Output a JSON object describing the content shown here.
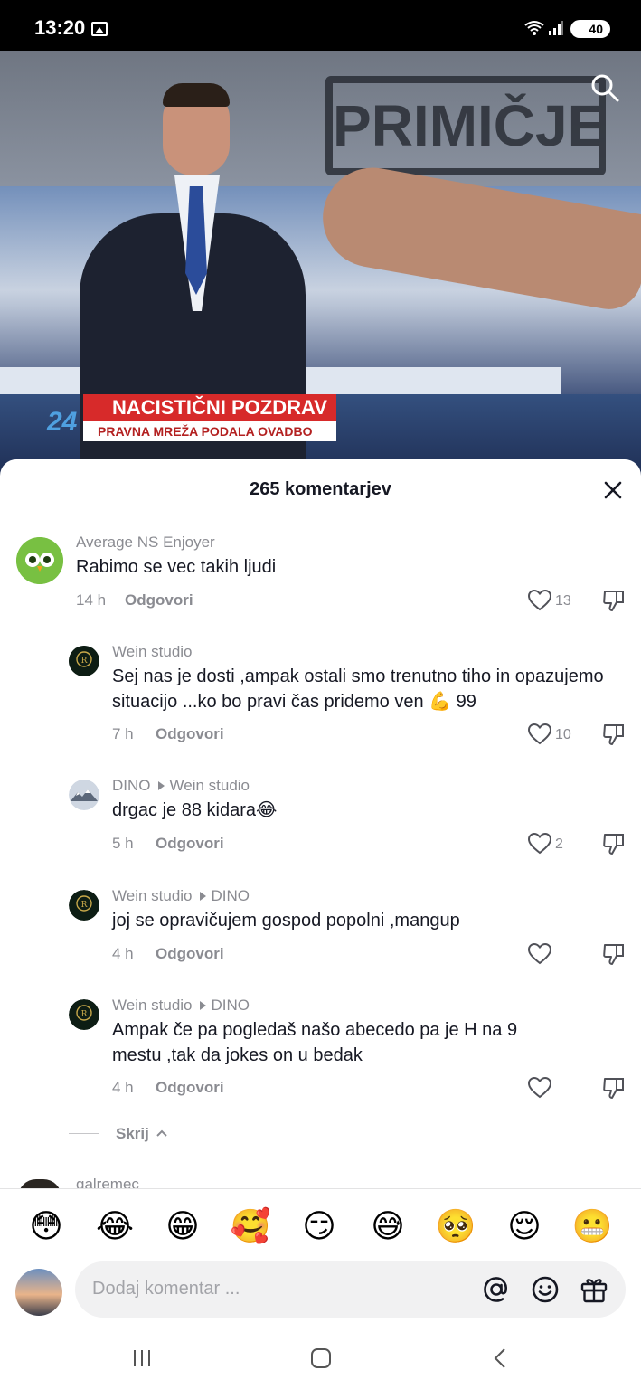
{
  "status_bar": {
    "time": "13:20",
    "battery": "40"
  },
  "video": {
    "studio_logo": "PRIMIČJE",
    "channel_mark": "24",
    "headline": "NACISTIČNI POZDRAV",
    "subheadline": "PRAVNA MREŽA PODALA OVADBO",
    "search_icon": "search-icon"
  },
  "sheet": {
    "title": "265 komentarjev",
    "close_icon": "close-icon"
  },
  "comments": [
    {
      "user": "Average NS Enjoyer",
      "reply_to": "",
      "text": "Rabimo se vec takih ljudi",
      "time": "14 h",
      "reply_label": "Odgovori",
      "likes": "13"
    },
    {
      "user": "Wein studio",
      "reply_to": "",
      "text": "Sej nas je dosti ,ampak ostali smo trenutno tiho in opazujemo situacijo ...ko bo pravi čas pridemo ven 💪 99",
      "time": "7 h",
      "reply_label": "Odgovori",
      "likes": "10"
    },
    {
      "user": "DINO",
      "reply_to": "Wein studio",
      "text": "drgac je 88 kidara😂",
      "time": "5 h",
      "reply_label": "Odgovori",
      "likes": "2"
    },
    {
      "user": "Wein studio",
      "reply_to": "DINO",
      "text": "joj se opravičujem gospod popolni ,mangup",
      "time": "4 h",
      "reply_label": "Odgovori",
      "likes": ""
    },
    {
      "user": "Wein studio",
      "reply_to": "DINO",
      "text": "Ampak če pa pogledaš našo abecedo pa je H na 9 mestu ,tak da jokes on u bedak",
      "time": "4 h",
      "reply_label": "Odgovori",
      "likes": ""
    }
  ],
  "hide_replies_label": "Skrij",
  "next_comment_user": "galremec",
  "emojis": [
    "😳",
    "😂",
    "😁",
    "🥰",
    "😏",
    "😅",
    "🥺",
    "😌",
    "😬"
  ],
  "input": {
    "placeholder": "Dodaj komentar ..."
  }
}
